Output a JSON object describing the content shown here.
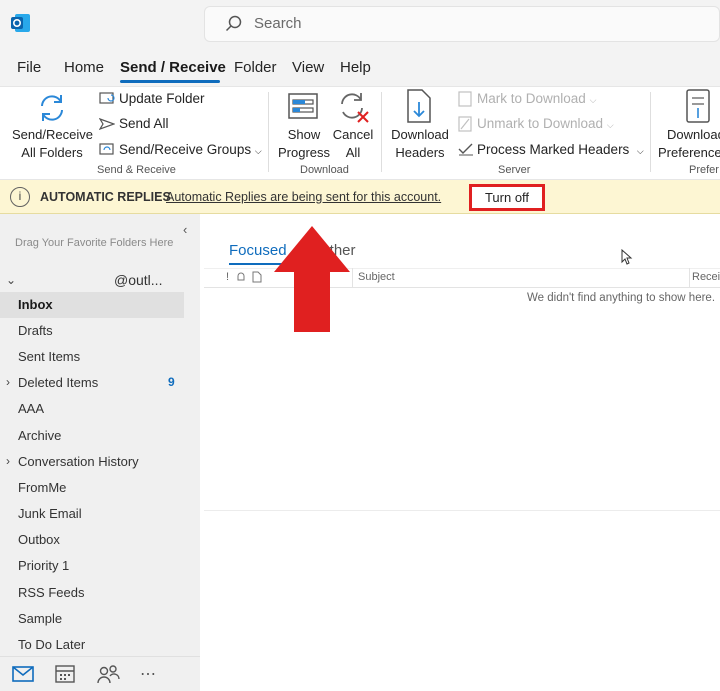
{
  "search": {
    "placeholder": "Search"
  },
  "menu": [
    {
      "label": "File"
    },
    {
      "label": "Home"
    },
    {
      "label": "Send / Receive"
    },
    {
      "label": "Folder"
    },
    {
      "label": "View"
    },
    {
      "label": "Help"
    }
  ],
  "active_menu": "Send / Receive",
  "ribbon": {
    "send_receive_all": [
      "Send/Receive",
      "All Folders"
    ],
    "update_folder": "Update Folder",
    "send_all": "Send All",
    "send_receive_groups": "Send/Receive Groups",
    "group_send_receive": "Send & Receive",
    "show_progress": [
      "Show",
      "Progress"
    ],
    "cancel_all": [
      "Cancel",
      "All"
    ],
    "group_download": "Download",
    "download_headers": [
      "Download",
      "Headers"
    ],
    "mark_to_download": "Mark to Download",
    "unmark_to_download": "Unmark to Download",
    "process_marked_headers": "Process Marked Headers",
    "group_server": "Server",
    "download_preferences": [
      "Download",
      "Preferences"
    ],
    "group_preferences": "Prefer"
  },
  "infobar": {
    "title": "AUTOMATIC REPLIES",
    "message": "Automatic Replies are being sent for this account.",
    "button": "Turn off",
    "highlight_color": "#e02020"
  },
  "sidebar": {
    "favorites_hint": "Drag Your Favorite Folders Here",
    "account": "@outl...",
    "folders": [
      {
        "label": "Inbox",
        "selected": true
      },
      {
        "label": "Drafts"
      },
      {
        "label": "Sent Items"
      },
      {
        "label": "Deleted Items",
        "count": "9",
        "expandable": true
      },
      {
        "label": "AAA"
      },
      {
        "label": "Archive"
      },
      {
        "label": "Conversation History",
        "expandable": true
      },
      {
        "label": "FromMe"
      },
      {
        "label": "Junk Email"
      },
      {
        "label": "Outbox"
      },
      {
        "label": "Priority 1"
      },
      {
        "label": "RSS Feeds"
      },
      {
        "label": "Sample"
      },
      {
        "label": "To Do Later"
      }
    ],
    "bottom_nav": [
      "mail-icon",
      "calendar-icon",
      "people-icon",
      "more-icon"
    ]
  },
  "mail_list": {
    "tabs": [
      {
        "label": "Focused"
      },
      {
        "label": "Other"
      }
    ],
    "columns": {
      "subject": "Subject",
      "received": "Recei"
    },
    "empty_message": "We didn't find anything to show here."
  },
  "colors": {
    "accent": "#0f6cbd",
    "arrow": "#e02020",
    "infobar_bg": "#fdf6d3"
  }
}
